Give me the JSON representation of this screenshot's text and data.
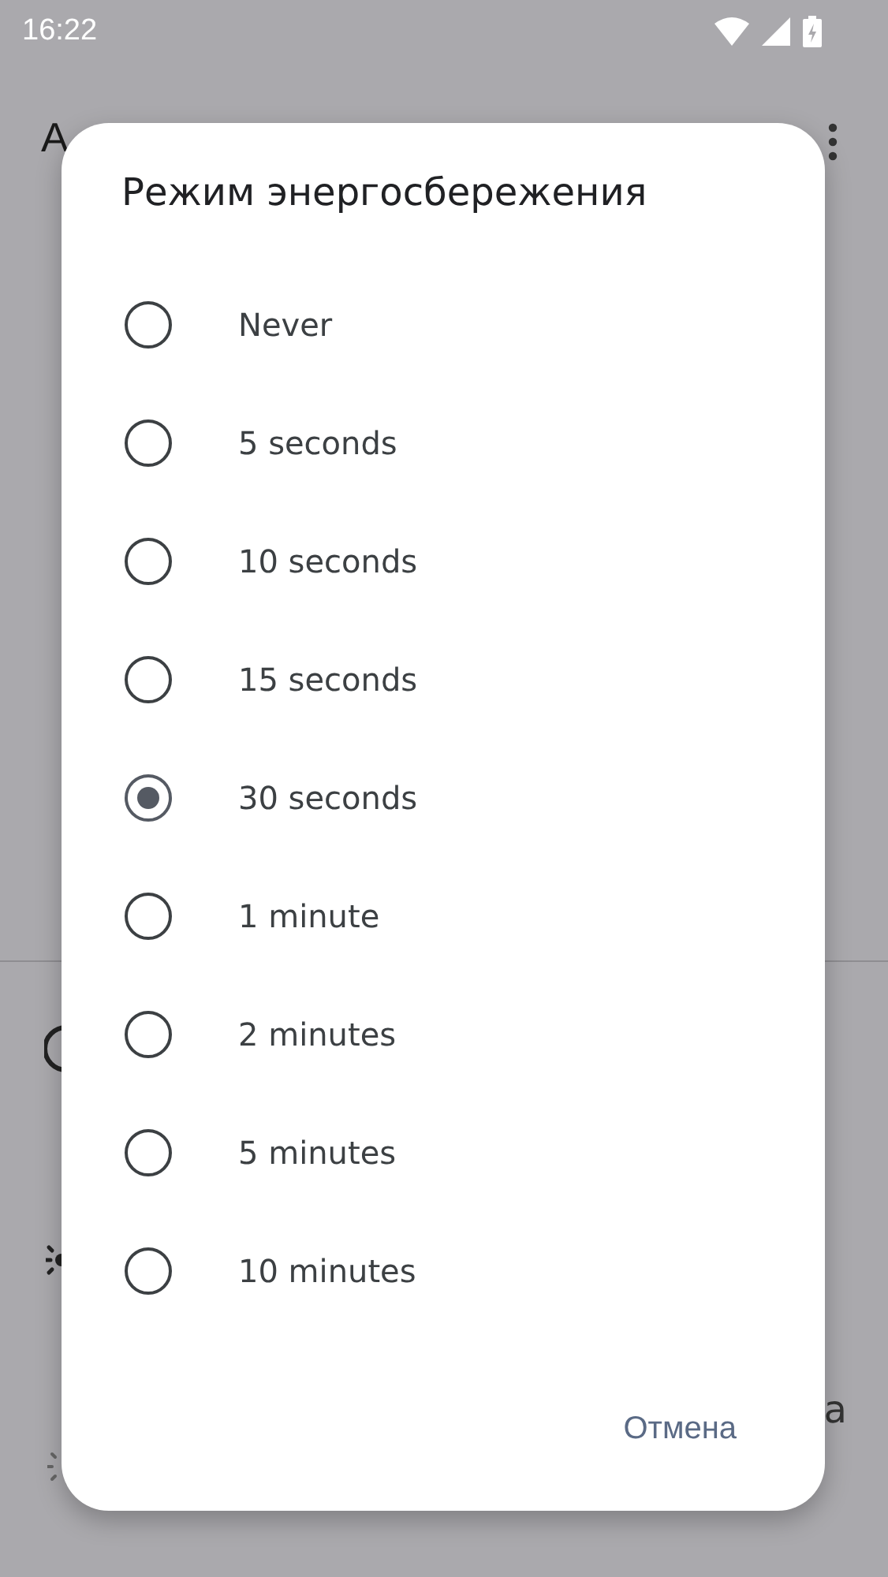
{
  "status_bar": {
    "time": "16:22"
  },
  "app_bar": {
    "title": "A"
  },
  "background": {
    "trailing_text": "a"
  },
  "dialog": {
    "title": "Режим энергосбережения",
    "options": [
      {
        "label": "Never",
        "selected": false
      },
      {
        "label": "5 seconds",
        "selected": false
      },
      {
        "label": "10 seconds",
        "selected": false
      },
      {
        "label": "15 seconds",
        "selected": false
      },
      {
        "label": "30 seconds",
        "selected": true
      },
      {
        "label": "1 minute",
        "selected": false
      },
      {
        "label": "2 minutes",
        "selected": false
      },
      {
        "label": "5 minutes",
        "selected": false
      },
      {
        "label": "10 minutes",
        "selected": false
      }
    ],
    "buttons": [
      "Отмена"
    ]
  }
}
